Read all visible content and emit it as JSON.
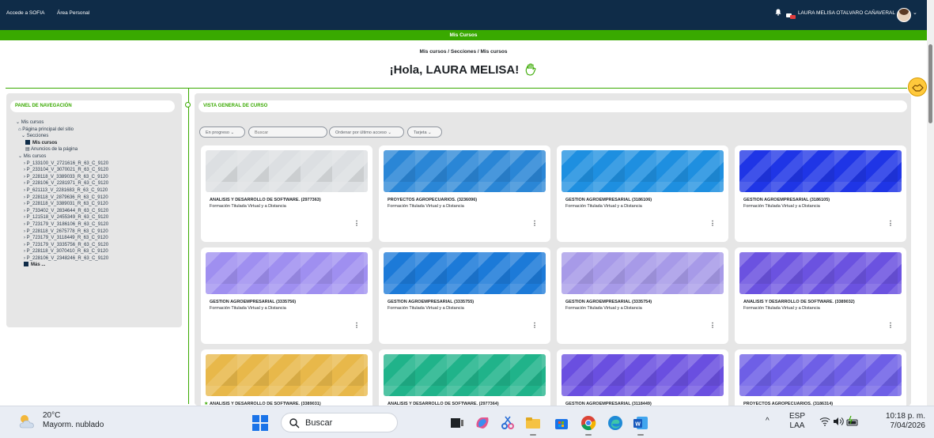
{
  "topbar": {
    "link1": "Accede a SOFIA",
    "link2": "Área Personal",
    "user_name": "LAURA MELISA OTALVARO CAÑAVERAL",
    "caret": "⌄"
  },
  "greenbar": {
    "title": "Mis Cursos"
  },
  "breadcrumb": "Mis cursos / Secciones / Mis cursos",
  "greeting": "¡Hola, LAURA MELISA!",
  "sidebar": {
    "title": "PANEL DE NAVEGACIÓN",
    "root": "Mis cursos",
    "home": "Página principal del sitio",
    "sections": "Secciones",
    "my_courses": "Mis cursos",
    "announcements": "Anuncios de la página",
    "courses_group": "Mis cursos",
    "items": [
      "P_133100_V_2721616_R_63_C_9120",
      "P_233104_V_3070021_R_63_C_9120",
      "P_228118_V_3389033_R_63_C_9120",
      "P_228106_V_2281971_R_63_C_9120",
      "P_621113_V_2281683_R_63_C_9120",
      "P_228118_V_2879636_R_63_C_9120",
      "P_228118_V_3389031_R_63_C_9120",
      "P_733402_V_2834644_R_63_C_9120",
      "P_121518_V_2455349_R_63_C_9120",
      "P_723179_V_3186106_R_63_C_9120",
      "P_228118_V_2675778_R_63_C_9120",
      "P_723179_V_3118449_R_63_C_9120",
      "P_723179_V_3335756_R_63_C_9120",
      "P_228118_V_3070410_R_63_C_9120",
      "P_228106_V_2348246_R_63_C_9120"
    ],
    "more": "Más ..."
  },
  "main": {
    "title": "VISTA GENERAL DE CURSO",
    "filter": "En progreso",
    "search_placeholder": "Buscar",
    "sort": "Ordenar por último acceso",
    "view": "Tarjeta"
  },
  "cards": [
    {
      "title": "ANALISIS Y DESARROLLO DE SOFTWARE. (2977363)",
      "subtitle": "Formación Titulada Virtual y a Distancia",
      "color": "#dcdfe2"
    },
    {
      "title": "PROYECTOS AGROPECUARIOS. (3236096)",
      "subtitle": "Formación Titulada Virtual y a Distancia",
      "color": "#2a86d6"
    },
    {
      "title": "GESTION AGROEMPRESARIAL (3186106)",
      "subtitle": "Formación Titulada Virtual y a Distancia",
      "color": "#1e8fe0"
    },
    {
      "title": "GESTION AGROEMPRESARIAL (3186105)",
      "subtitle": "Formación Titulada Virtual y a Distancia",
      "color": "#1f35e6"
    },
    {
      "title": "GESTION AGROEMPRESARIAL (3335756)",
      "subtitle": "Formación Titulada Virtual y a Distancia",
      "color": "#9f8ff0"
    },
    {
      "title": "GESTION AGROEMPRESARIAL (3335755)",
      "subtitle": "Formación Titulada Virtual y a Distancia",
      "color": "#1c7ad8"
    },
    {
      "title": "GESTION AGROEMPRESARIAL (3335754)",
      "subtitle": "Formación Titulada Virtual y a Distancia",
      "color": "#a79ae8"
    },
    {
      "title": "ANALISIS Y DESARROLLO DE SOFTWARE. (3389032)",
      "subtitle": "Formación Titulada Virtual y a Distancia",
      "color": "#6b52e0"
    },
    {
      "title": "ANALISIS Y DESARROLLO DE SOFTWARE. (3389031)",
      "subtitle": "",
      "color": "#e8b84a"
    },
    {
      "title": "ANALISIS Y DESARROLLO DE SOFTWARE. (2977364)",
      "subtitle": "",
      "color": "#20b38a"
    },
    {
      "title": "GESTION AGROEMPRESARIAL (3118449)",
      "subtitle": "",
      "color": "#6a4fe0"
    },
    {
      "title": "PROYECTOS AGROPECUARIOS. (3186314)",
      "subtitle": "",
      "color": "#6e5fe6"
    }
  ],
  "card_menu": "⋮",
  "taskbar": {
    "temperature": "20°C",
    "weather": "Mayorm. nublado",
    "search": "Buscar",
    "lang1": "ESP",
    "lang2": "LAA",
    "time": "10:18 p. m.",
    "date": "7/04/2026"
  }
}
